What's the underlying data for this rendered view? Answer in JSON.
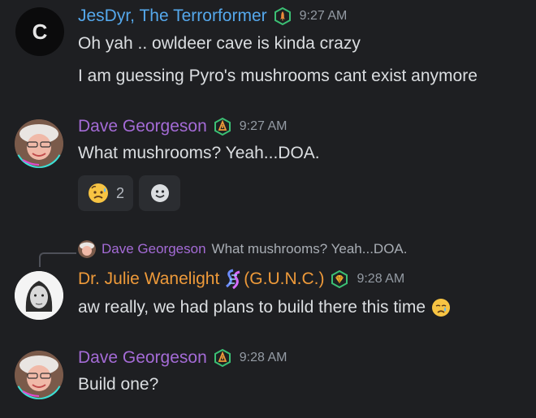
{
  "colors": {
    "blue_user": "#55a8ec",
    "purple_user": "#a46bd6",
    "orange_user": "#ee9a3a",
    "badge_green": "#3bbf74"
  },
  "messages": [
    {
      "author": "JesDyr, The Terrorformer",
      "time": "9:27 AM",
      "avatar_letter": "C",
      "badge_icon": "rocket-badge-icon",
      "lines": [
        "Oh yah .. owldeer cave is kinda crazy",
        "I am guessing Pyro's mushrooms cant exist anymore"
      ]
    },
    {
      "author": "Dave Georgeson",
      "time": "9:27 AM",
      "badge_icon": "shield-badge-icon",
      "lines": [
        "What mushrooms? Yeah...DOA."
      ],
      "reactions": [
        {
          "emoji_icon": "sad-sweat-face-icon",
          "count": "2"
        },
        {
          "emoji_icon": "add-reaction-smiley-icon"
        }
      ]
    },
    {
      "reply_to": {
        "author": "Dave Georgeson",
        "text": "What mushrooms? Yeah...DOA."
      },
      "author": "Dr. Julie Wanelight",
      "author_suffix": "(G.U.N.C.)",
      "time": "9:28 AM",
      "badge_icon": "gem-badge-icon",
      "lines": [
        "aw really, we had plans to build there this time"
      ]
    },
    {
      "author": "Dave Georgeson",
      "time": "9:28 AM",
      "badge_icon": "shield-badge-icon",
      "lines": [
        "Build one?"
      ]
    }
  ]
}
